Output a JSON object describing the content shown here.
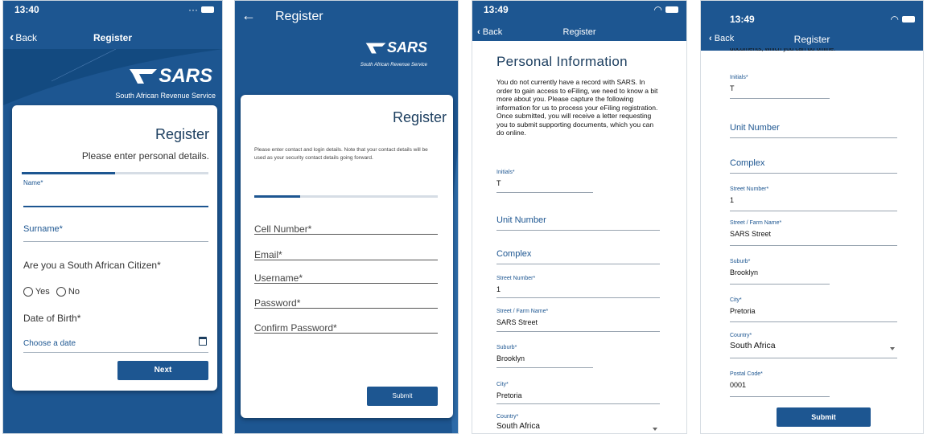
{
  "s1": {
    "time": "13:40",
    "back": "Back",
    "title": "Register",
    "logo": "SARS",
    "tagline": "South African Revenue Service",
    "card_title": "Register",
    "card_sub": "Please enter personal details.",
    "progress": 0.5,
    "name_label": "Name*",
    "surname_label": "Surname*",
    "citizen_q": "Are you a South African Citizen*",
    "yes": "Yes",
    "no": "No",
    "dob_label": "Date of Birth*",
    "dob_placeholder": "Choose a date",
    "next": "Next"
  },
  "s2": {
    "title": "Register",
    "logo": "SARS",
    "tagline": "South African Revenue Service",
    "card_title": "Register",
    "intro": "Please enter contact and login details. Note that your contact details will be used as your security contact details going forward.",
    "progress": 0.25,
    "cell": "Cell Number*",
    "email": "Email*",
    "username": "Username*",
    "password": "Password*",
    "confirm": "Confirm Password*",
    "submit": "Submit"
  },
  "s3": {
    "time": "13:49",
    "back": "Back",
    "title": "Register",
    "heading": "Personal Information",
    "intro": "You do not currently have a record with SARS. In order to gain access to eFiling, we need to know a bit more about you. Please capture the following information for us to process your eFiling registration. Once submitted, you will receive a letter requesting you to submit supporting documents, which you can do online.",
    "initials_label": "Initials*",
    "initials": "T",
    "unit": "Unit Number",
    "complex": "Complex",
    "street_no_label": "Street Number*",
    "street_no": "1",
    "street_label": "Street / Farm Name*",
    "street": "SARS Street",
    "suburb_label": "Suburb*",
    "suburb": "Brooklyn",
    "city_label": "City*",
    "city": "Pretoria",
    "country_label": "Country*",
    "country": "South Africa"
  },
  "s4": {
    "time": "13:49",
    "back": "Back",
    "title": "Register",
    "top_cut": "documents, which you can do online.",
    "initials_label": "Initials*",
    "initials": "T",
    "unit": "Unit Number",
    "complex": "Complex",
    "street_no_label": "Street Number*",
    "street_no": "1",
    "street_label": "Street / Farm Name*",
    "street": "SARS Street",
    "suburb_label": "Suburb*",
    "suburb": "Brooklyn",
    "city_label": "City*",
    "city": "Pretoria",
    "country_label": "Country*",
    "country": "South Africa",
    "postal_label": "Postal Code*",
    "postal": "0001",
    "submit": "Submit"
  },
  "colors": {
    "brand_blue": "#1d5691",
    "dark_blue": "#134a80"
  }
}
